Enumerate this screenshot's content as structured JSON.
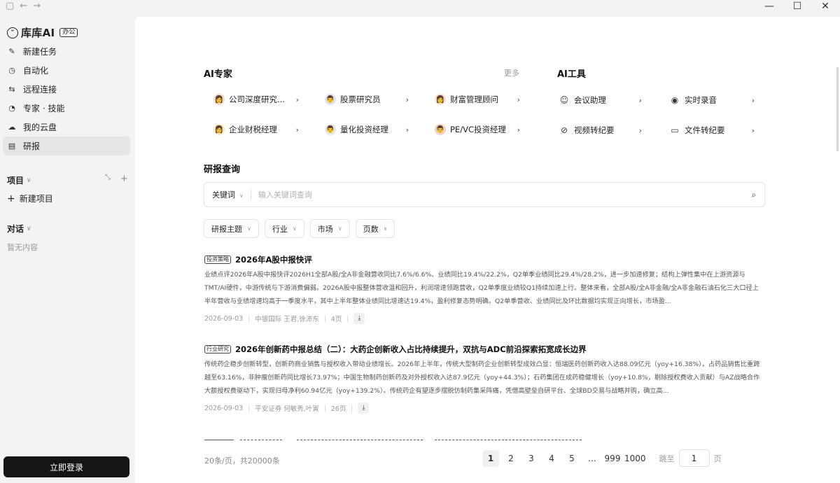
{
  "titlebar": {
    "left_icons": [
      "sidebar-toggle-icon",
      "back-arrow-icon",
      "forward-arrow-icon"
    ],
    "window_controls": [
      "minimize-icon",
      "maximize-icon",
      "close-icon"
    ]
  },
  "sidebar": {
    "brand": {
      "name": "库库AI",
      "badge": "办公"
    },
    "nav": [
      {
        "label": "新建任务",
        "icon": "edit-icon"
      },
      {
        "label": "自动化",
        "icon": "clock-icon"
      },
      {
        "label": "远程连接",
        "icon": "remote-icon"
      },
      {
        "label": "专家 · 技能",
        "icon": "expert-icon"
      },
      {
        "label": "我的云盘",
        "icon": "cloud-icon"
      },
      {
        "label": "研报",
        "icon": "report-icon",
        "active": true
      }
    ],
    "projects_label": "项目",
    "new_project_label": "新建项目",
    "chats_label": "对话",
    "chats_empty": "暂无内容",
    "login_button": "立即登录"
  },
  "experts": {
    "title": "AI专家",
    "more": "更多",
    "items": [
      {
        "label": "公司深度研究...",
        "icon": "expert-avatar-icon"
      },
      {
        "label": "股票研究员",
        "icon": "expert-avatar-icon"
      },
      {
        "label": "财富管理顾问",
        "icon": "expert-avatar-icon"
      },
      {
        "label": "企业财税经理",
        "icon": "expert-avatar-icon"
      },
      {
        "label": "量化投资经理",
        "icon": "expert-avatar-icon"
      },
      {
        "label": "PE/VC投资经理",
        "icon": "expert-avatar-icon"
      }
    ]
  },
  "tools": {
    "title": "AI工具",
    "items": [
      {
        "label": "会议助理",
        "icon": "meeting-assistant-icon"
      },
      {
        "label": "实时录音",
        "icon": "live-recording-icon"
      },
      {
        "label": "视频转纪要",
        "icon": "link-icon"
      },
      {
        "label": "文件转纪要",
        "icon": "file-convert-icon"
      }
    ]
  },
  "query": {
    "title": "研报查询",
    "search_type": "关键词",
    "placeholder": "输入关键词查询",
    "value": "",
    "filters": [
      "研报主题",
      "行业",
      "市场",
      "页数"
    ]
  },
  "reports": [
    {
      "tag": "投资策略",
      "title": "2026年A股中报快评",
      "summary": "业绩点评2026年A股中报快评2026H1全部A股/全A非金融营收同比7.6%/6.6%、业绩同比19.4%/22.2%，Q2单季业绩同比29.4%/28.2%，进一步加速修复；结构上弹性集中在上游资源与TMT/AI硬件，中游传统与下游消费偏弱。2026A股中报整体营收温和回升，利润增速领跑营收，Q2单季度业绩较Q1持续加速上行。整体来看，全部A股/全A非金融/全A非金融石油石化三大口径上半年营收与业绩增速均高于一季度水平，其中上半年整体业绩同比增速达19.4%，盈利修复态势明确。Q2单季营收、业绩同比及环比数据均实现正向增长，市场盈...",
      "date": "2026-09-03",
      "source": "中银国际 王君,徐沛东",
      "pages": "4页"
    },
    {
      "tag": "行业研究",
      "title": "2026年创新药中报总结（二）：大药企创新收入占比持续提升，双抗与ADC前沿探索拓宽成长边界",
      "summary": "传统药企稳步创新转型，创新药商业销售与授权收入带动业绩增长。2026年上半年，传统大型制药企业创新转型成效凸显：恒瑞医药创新药收入达88.09亿元（yoy+16.38%），占药品销售比重跨越至63.16%，非肿瘤创新药同比增长73.97%；中国生物制药创新药及对外授权收入达87.9亿元（yoy+44.3%）；石药集团在成药稳健增长（yoy+10.8%，剔除授权费收入贡献）与AZ战略合作大额授权费驱动下，实现归母净利60.94亿元（yoy+139.2%）。传统药企有望逐步摆脱仿制药集采阵痛，凭借高壁垒自研平台、全球BD交易与战略并购，确立高...",
      "date": "2026-09-03",
      "source": "平安证券 何敏秀,叶寅",
      "pages": "26页"
    }
  ],
  "pagination": {
    "info": "20条/页，共20000条",
    "prev": "‹",
    "pages": [
      "1",
      "2",
      "3",
      "4",
      "5",
      "...",
      "999",
      "1000"
    ],
    "current": "1",
    "next": "›",
    "jump_prefix": "跳至",
    "jump_value": "1",
    "jump_suffix": "页"
  }
}
